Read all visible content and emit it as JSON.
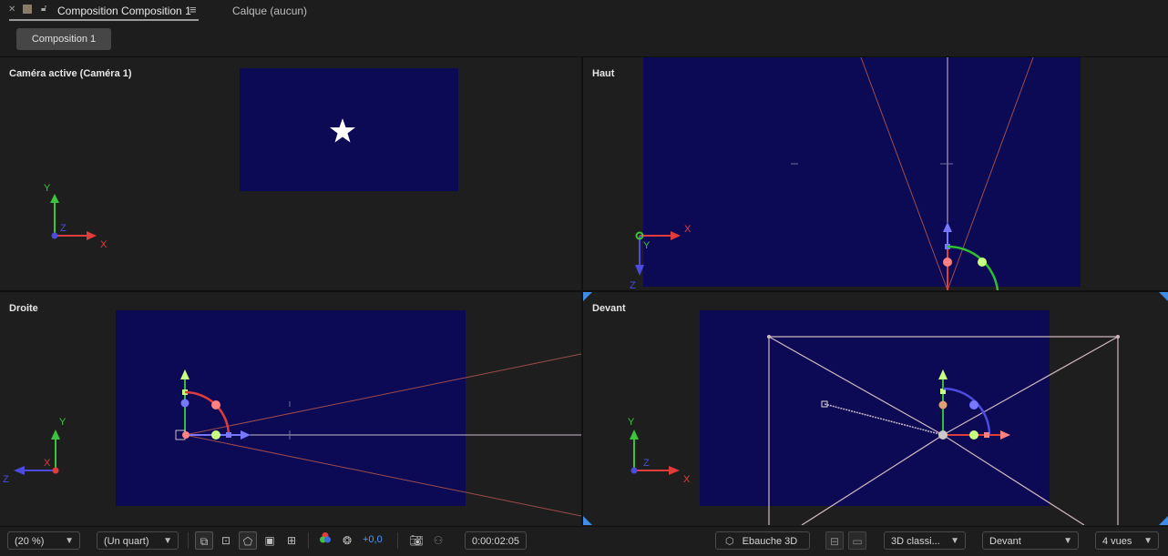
{
  "header": {
    "tab_title": "Composition Composition 1",
    "layer_tab": "Calque (aucun)",
    "breadcrumb": "Composition 1"
  },
  "views": {
    "active_camera": {
      "label": "Caméra active (Caméra 1)"
    },
    "top": {
      "label": "Haut"
    },
    "right": {
      "label": "Droite"
    },
    "front": {
      "label": "Devant"
    }
  },
  "axes": {
    "x": "X",
    "y": "Y",
    "z": "Z"
  },
  "toolbar": {
    "zoom": "(20 %)",
    "resolution": "(Un quart)",
    "exposure": "+0,0",
    "timecode": "0:00:02:05",
    "draft3d": "Ebauche 3D",
    "renderer": "3D classi...",
    "view": "Devant",
    "layout": "4 vues"
  },
  "colors": {
    "comp_bg": "#0c0a55",
    "axis_x": "#e03c3c",
    "axis_y": "#3cc43c",
    "axis_z": "#4b4be0",
    "accent": "#3f8ce6"
  }
}
